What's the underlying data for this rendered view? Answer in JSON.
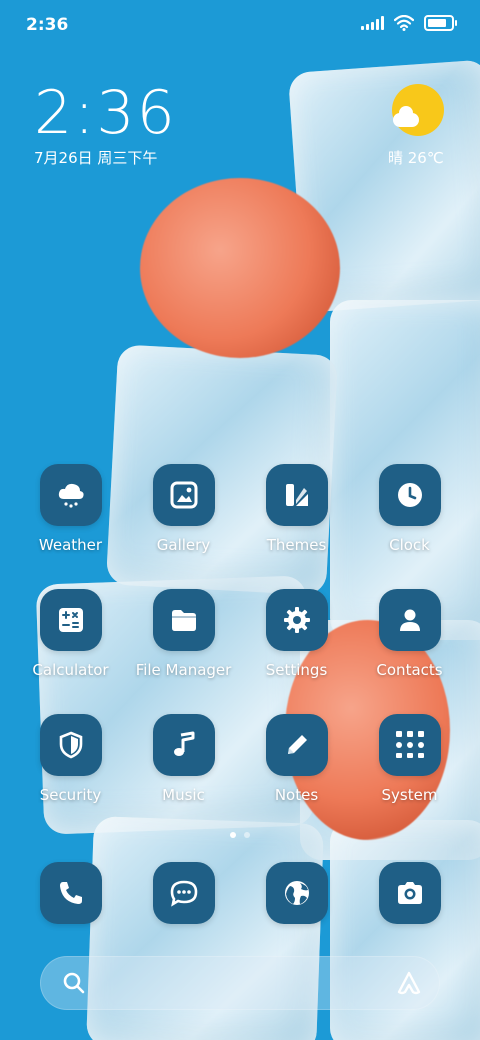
{
  "status_bar": {
    "time": "2:36",
    "battery_level": 0.85
  },
  "lockclock": {
    "time": "2:36",
    "date": "7月26日 周三下午"
  },
  "weather": {
    "text": "晴 26℃",
    "icon": "sun-cloud-icon"
  },
  "apps": [
    {
      "label": "Weather",
      "icon": "cloud-snow-icon"
    },
    {
      "label": "Gallery",
      "icon": "image-icon"
    },
    {
      "label": "Themes",
      "icon": "palette-icon"
    },
    {
      "label": "Clock",
      "icon": "clock-icon"
    },
    {
      "label": "Calculator",
      "icon": "calculator-icon"
    },
    {
      "label": "File Manager",
      "icon": "folder-icon"
    },
    {
      "label": "Settings",
      "icon": "gear-icon"
    },
    {
      "label": "Contacts",
      "icon": "contact-icon"
    },
    {
      "label": "Security",
      "icon": "shield-icon"
    },
    {
      "label": "Music",
      "icon": "music-note-icon"
    },
    {
      "label": "Notes",
      "icon": "pencil-icon"
    },
    {
      "label": "System",
      "icon": "system-folder-icon"
    }
  ],
  "dock": [
    {
      "icon": "phone-icon"
    },
    {
      "icon": "message-icon"
    },
    {
      "icon": "globe-icon"
    },
    {
      "icon": "camera-icon"
    }
  ],
  "page_indicator": {
    "count": 2,
    "active": 0
  },
  "colors": {
    "icon_bg": "#1f5f86",
    "wallpaper": "#1c9ad6",
    "sun": "#f8c81a"
  }
}
